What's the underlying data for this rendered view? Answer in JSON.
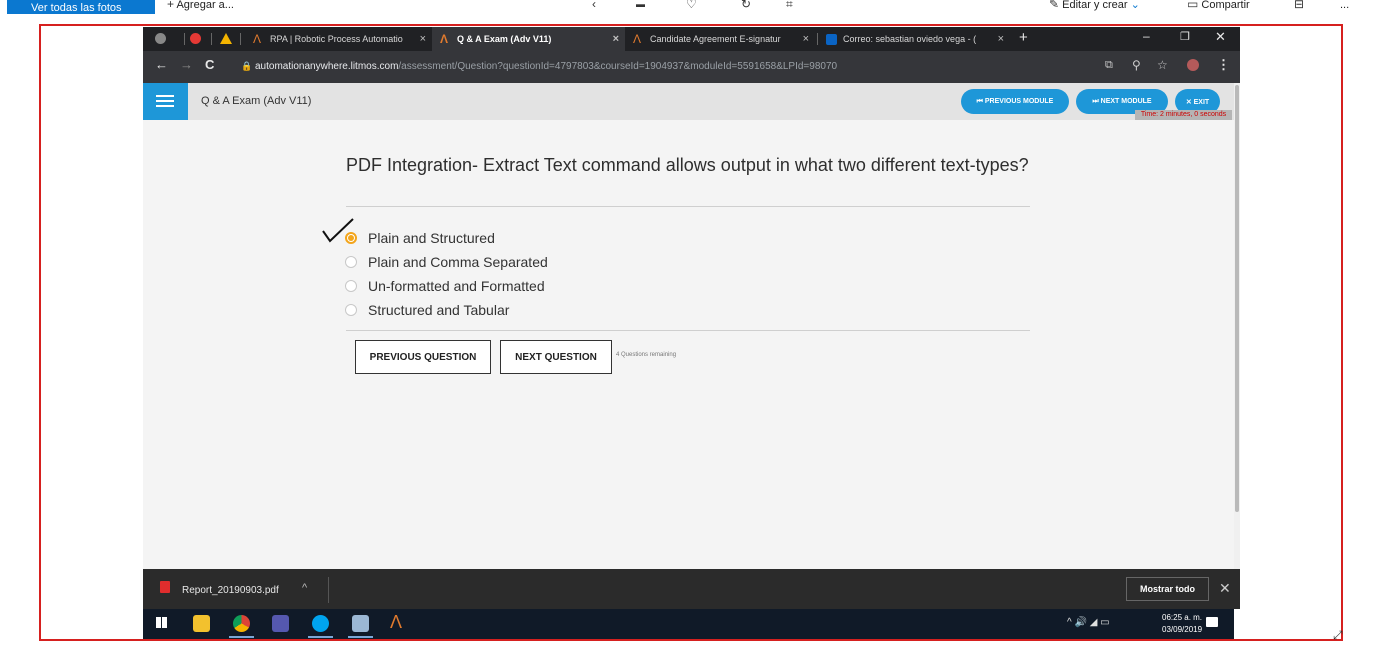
{
  "photos_app": {
    "view_all_label": "Ver todas las fotos",
    "add_label": "Agregar a...",
    "edit_create_label": "Editar y crear",
    "share_label": "Compartir",
    "more_label": "..."
  },
  "browser": {
    "tabs": [
      {
        "label": "RPA | Robotic Process Automatio",
        "active": false
      },
      {
        "label": "Q & A Exam (Adv V11)",
        "active": true
      },
      {
        "label": "Candidate Agreement E-signatur",
        "active": false
      },
      {
        "label": "Correo: sebastian oviedo vega - (",
        "active": false
      }
    ],
    "url_host": "automationanywhere.litmos.com",
    "url_path": "/assessment/Question?questionId=4797803&courseId=1904937&moduleId=5591658&LPId=98070"
  },
  "exam": {
    "title": "Q & A Exam (Adv V11)",
    "prev_module_label": "⏮ PREVIOUS MODULE",
    "next_module_label": "⏭ NEXT MODULE",
    "exit_label": "✕ EXIT",
    "timer_text": "Time: 2 minutes, 0 seconds",
    "question": "PDF Integration- Extract Text command allows output in what two different text-types?",
    "options": [
      {
        "label": "Plain and Structured",
        "selected": true
      },
      {
        "label": "Plain and Comma Separated",
        "selected": false
      },
      {
        "label": "Un-formatted and Formatted",
        "selected": false
      },
      {
        "label": "Structured and Tabular",
        "selected": false
      }
    ],
    "prev_question_label": "PREVIOUS QUESTION",
    "next_question_label": "NEXT QUESTION",
    "remaining_text": "4 Questions remaining"
  },
  "downloads": {
    "file_name": "Report_20190903.pdf",
    "show_all_label": "Mostrar todo"
  },
  "taskbar": {
    "time": "06:25 a. m.",
    "date": "03/09/2019"
  },
  "colors": {
    "accent_blue": "#1e97d8",
    "radio_selected": "#f3a51c",
    "frame_red": "#d6201f",
    "photos_blue": "#0b78d0"
  }
}
